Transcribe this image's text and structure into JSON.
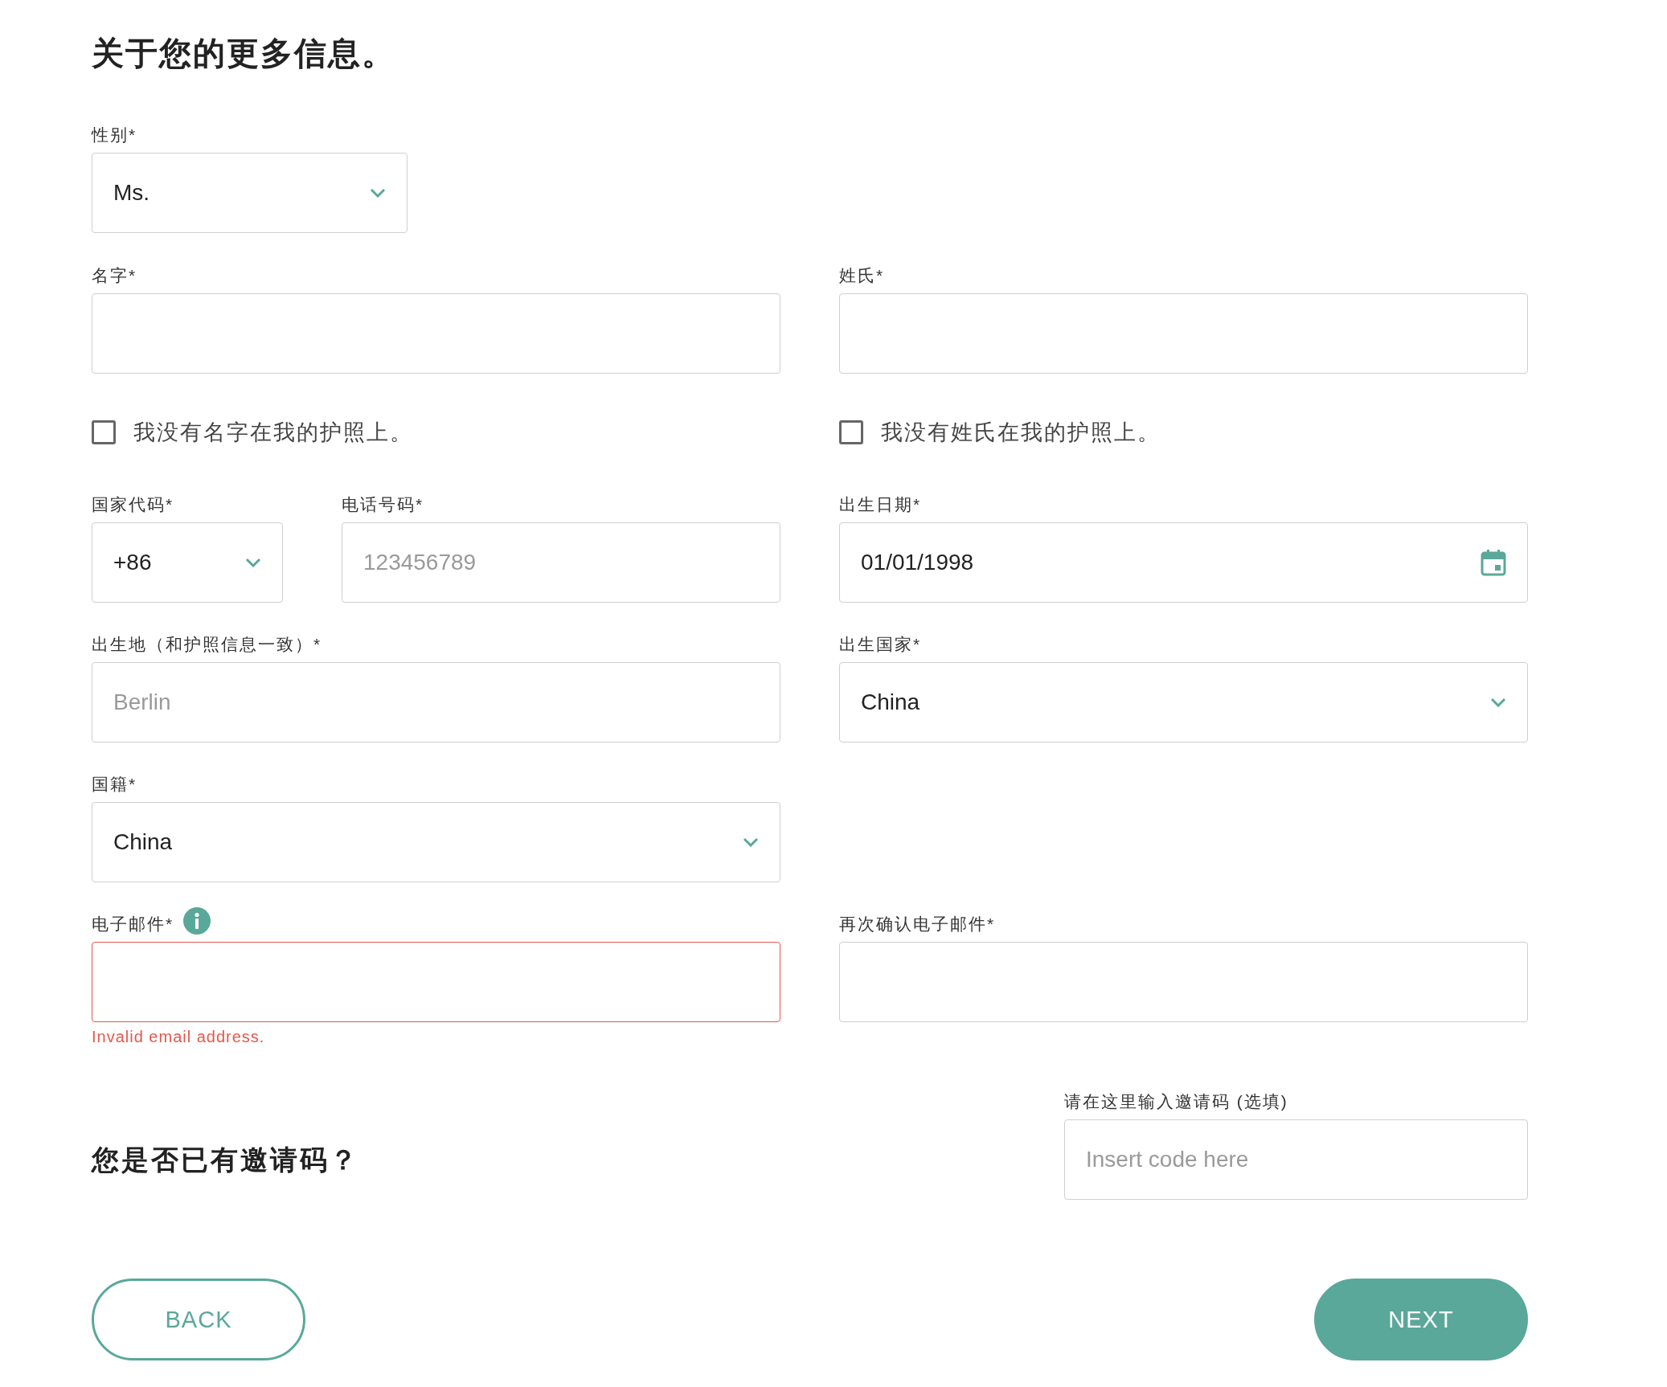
{
  "title": "关于您的更多信息。",
  "gender": {
    "label": "性别*",
    "value": "Ms."
  },
  "given_name": {
    "label": "名字*"
  },
  "surname": {
    "label": "姓氏*"
  },
  "checkboxes": [
    {
      "label": "我没有名字在我的护照上。",
      "checked": false
    },
    {
      "label": "我没有姓氏在我的护照上。",
      "checked": false
    }
  ],
  "country_code": {
    "label": "国家代码*",
    "value": "+86"
  },
  "phone": {
    "label": "电话号码*",
    "placeholder": "123456789"
  },
  "birth_date": {
    "label": "出生日期*",
    "value": "01/01/1998"
  },
  "birth_place": {
    "label": "出生地（和护照信息一致）*",
    "placeholder": "Berlin"
  },
  "birth_country": {
    "label": "出生国家*",
    "value": "China"
  },
  "nationality": {
    "label": "国籍*",
    "value": "China"
  },
  "email": {
    "label": "电子邮件*",
    "invalid": true,
    "error": "Invalid email address."
  },
  "email_confirm": {
    "label": "再次确认电子邮件*"
  },
  "invite": {
    "heading": "您是否已有邀请码？",
    "label": "请在这里输入邀请码 (选填)",
    "placeholder": "Insert code here"
  },
  "buttons": [
    {
      "label": "BACK",
      "kind": "outline"
    },
    {
      "label": "NEXT",
      "kind": "filled"
    }
  ]
}
